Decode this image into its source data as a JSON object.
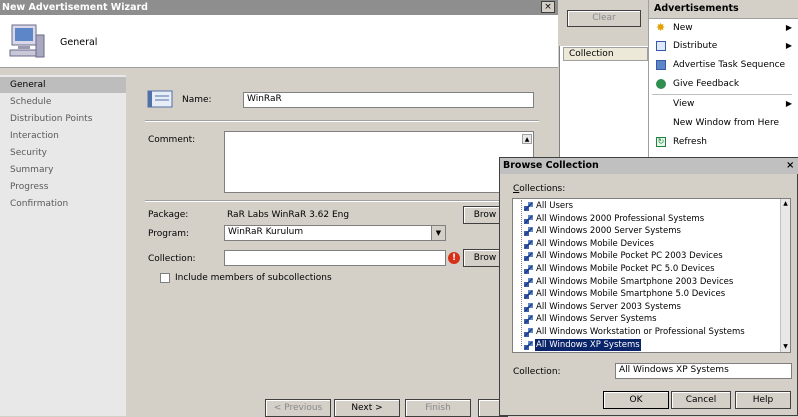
{
  "wizard": {
    "title": "New Advertisement Wizard",
    "close": "×",
    "header_label": "General",
    "nav": [
      "General",
      "Schedule",
      "Distribution Points",
      "Interaction",
      "Security",
      "Summary",
      "Progress",
      "Confirmation"
    ],
    "name_label": "Name:",
    "name_value": "WinRaR",
    "comment_label": "Comment:",
    "comment_value": "",
    "package_label": "Package:",
    "package_value": "RaR Labs WinRaR 3.62 Eng",
    "program_label": "Program:",
    "program_value": "WinRaR Kurulum",
    "collection_label": "Collection:",
    "collection_value": "",
    "browse1": "Brow",
    "browse2": "Brow",
    "include_label": "Include members of subcollections",
    "btn_previous": "< Previous",
    "btn_next": "Next >",
    "btn_finish": "Finish"
  },
  "mid_pane": {
    "clear": "Clear",
    "column_header": "Collection"
  },
  "actions": {
    "title": "Advertisements",
    "items": [
      {
        "label": "New",
        "submenu": true,
        "icon": "new-star-icon"
      },
      {
        "label": "Distribute",
        "submenu": true,
        "icon": "distribute-icon"
      },
      {
        "label": "Advertise Task Sequence",
        "submenu": false,
        "icon": "advertise-icon"
      },
      {
        "label": "Give Feedback",
        "submenu": false,
        "icon": "globe-icon"
      },
      {
        "label": "View",
        "submenu": true,
        "icon": ""
      },
      {
        "label": "New Window from Here",
        "submenu": false,
        "icon": ""
      },
      {
        "label": "Refresh",
        "submenu": false,
        "icon": "refresh-icon"
      }
    ]
  },
  "dialog": {
    "title": "Browse Collection",
    "close": "×",
    "collections_label": "Collections:",
    "items": [
      "All Users",
      "All Windows 2000 Professional Systems",
      "All Windows 2000 Server Systems",
      "All Windows Mobile Devices",
      "All Windows Mobile Pocket PC 2003 Devices",
      "All Windows Mobile Pocket PC 5.0 Devices",
      "All Windows Mobile Smartphone 2003 Devices",
      "All Windows Mobile Smartphone 5.0 Devices",
      "All Windows Server 2003 Systems",
      "All Windows Server Systems",
      "All Windows Workstation or Professional Systems",
      "All Windows XP Systems"
    ],
    "selected_index": 11,
    "collection_label": "Collection:",
    "collection_value": "All Windows XP Systems",
    "ok": "OK",
    "cancel": "Cancel",
    "help": "Help"
  }
}
